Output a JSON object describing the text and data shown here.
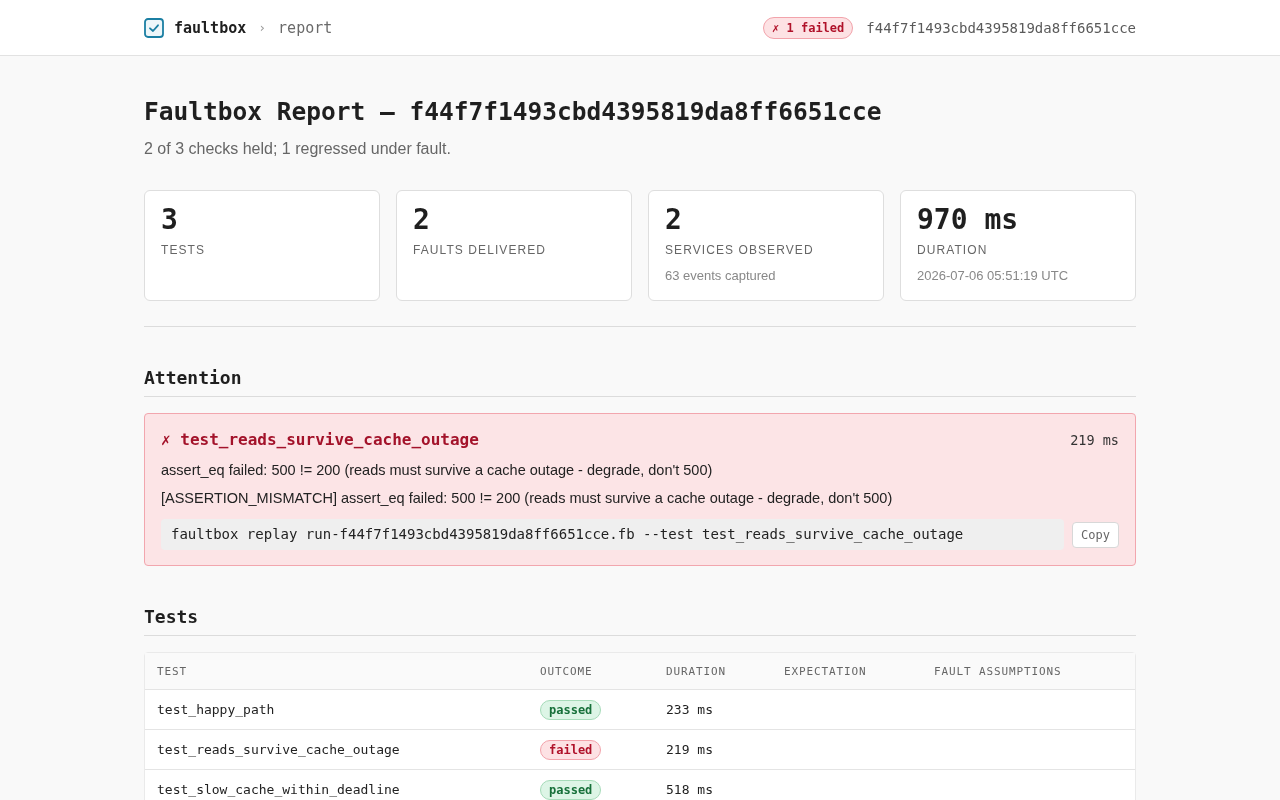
{
  "header": {
    "brand": "faultbox",
    "separator": "›",
    "crumb": "report",
    "badge": "✗ 1 failed",
    "run_id": "f44f7f1493cbd4395819da8ff6651cce"
  },
  "title": "Faultbox Report — f44f7f1493cbd4395819da8ff6651cce",
  "subtitle": "2 of 3 checks held; 1 regressed under fault.",
  "stats": [
    {
      "value": "3",
      "label": "TESTS"
    },
    {
      "value": "2",
      "label": "FAULTS DELIVERED"
    },
    {
      "value": "2",
      "label": "SERVICES OBSERVED",
      "note": "63 events captured"
    },
    {
      "value": "970 ms",
      "label": "DURATION",
      "note": "2026-07-06 05:51:19 UTC"
    }
  ],
  "attention": {
    "heading": "Attention",
    "failures": [
      {
        "title": "✗ test_reads_survive_cache_outage",
        "duration": "219 ms",
        "messages": [
          "assert_eq failed: 500 != 200 (reads must survive a cache outage - degrade, don't 500)",
          "[ASSERTION_MISMATCH] assert_eq failed: 500 != 200 (reads must survive a cache outage - degrade, don't 500)"
        ],
        "command": "faultbox replay run-f44f7f1493cbd4395819da8ff6651cce.fb --test test_reads_survive_cache_outage",
        "copy_button": "Copy"
      }
    ]
  },
  "tests": {
    "heading": "Tests",
    "columns": [
      "TEST",
      "OUTCOME",
      "DURATION",
      "EXPECTATION",
      "FAULT ASSUMPTIONS"
    ],
    "rows": [
      {
        "test": "test_happy_path",
        "outcome": "passed",
        "failed": false,
        "duration": "233 ms"
      },
      {
        "test": "test_reads_survive_cache_outage",
        "outcome": "failed",
        "failed": true,
        "duration": "219 ms"
      },
      {
        "test": "test_slow_cache_within_deadline",
        "outcome": "passed",
        "failed": false,
        "duration": "518 ms"
      }
    ]
  }
}
